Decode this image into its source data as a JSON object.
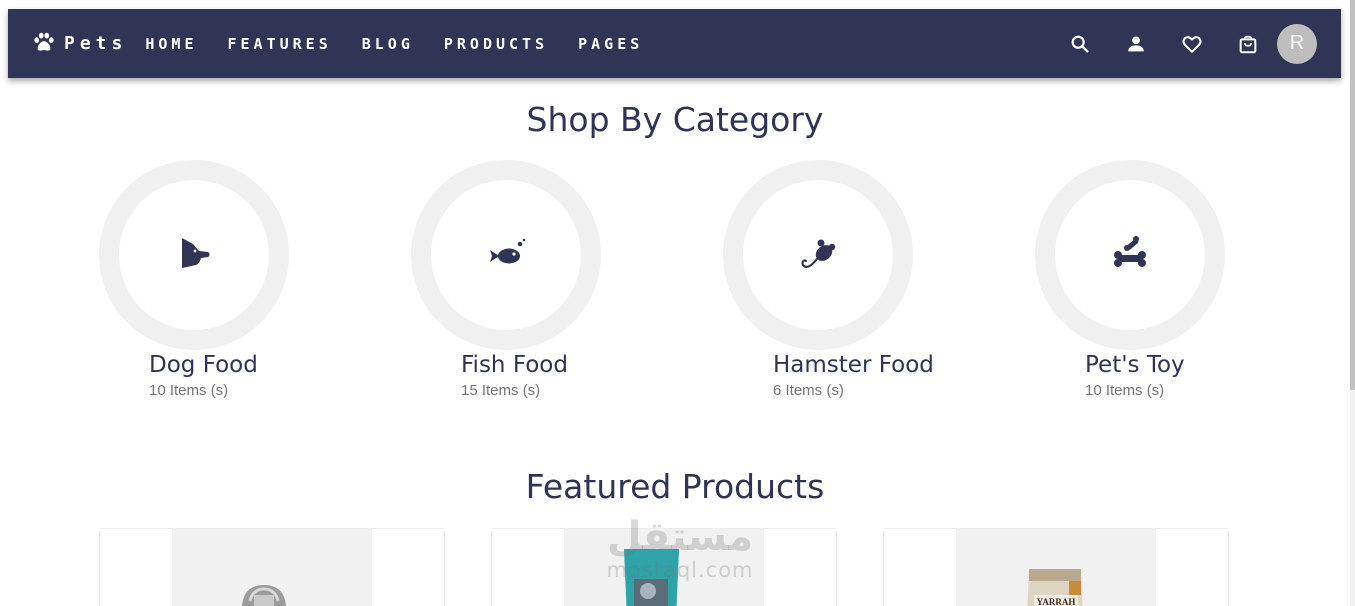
{
  "nav": {
    "brand": "Pets",
    "links": [
      "HOME",
      "FEATURES",
      "BLOG",
      "PRODUCTS",
      "PAGES"
    ],
    "icons": [
      "search-icon",
      "user-icon",
      "heart-icon",
      "shopping-bag-icon"
    ],
    "avatar_initial": "R"
  },
  "categories_section": {
    "title": "Shop By Category",
    "items": [
      {
        "name": "Dog Food",
        "count": "10 Items (s)",
        "icon": "dog-icon"
      },
      {
        "name": "Fish Food",
        "count": "15 Items (s)",
        "icon": "fish-icon"
      },
      {
        "name": "Hamster Food",
        "count": "6 Items (s)",
        "icon": "hamster-icon"
      },
      {
        "name": "Pet's Toy",
        "count": "10 Items (s)",
        "icon": "bone-toy-icon"
      }
    ]
  },
  "featured_section": {
    "title": "Featured Products",
    "product_label": "YARRAH"
  },
  "watermark": {
    "arabic": "مستقل",
    "latin": "mostaql.com"
  },
  "colors": {
    "navbar": "#303455",
    "text_dark": "#2f3456",
    "ring": "#f0f0f0",
    "muted": "#757575",
    "avatar": "#bdbdbd"
  }
}
